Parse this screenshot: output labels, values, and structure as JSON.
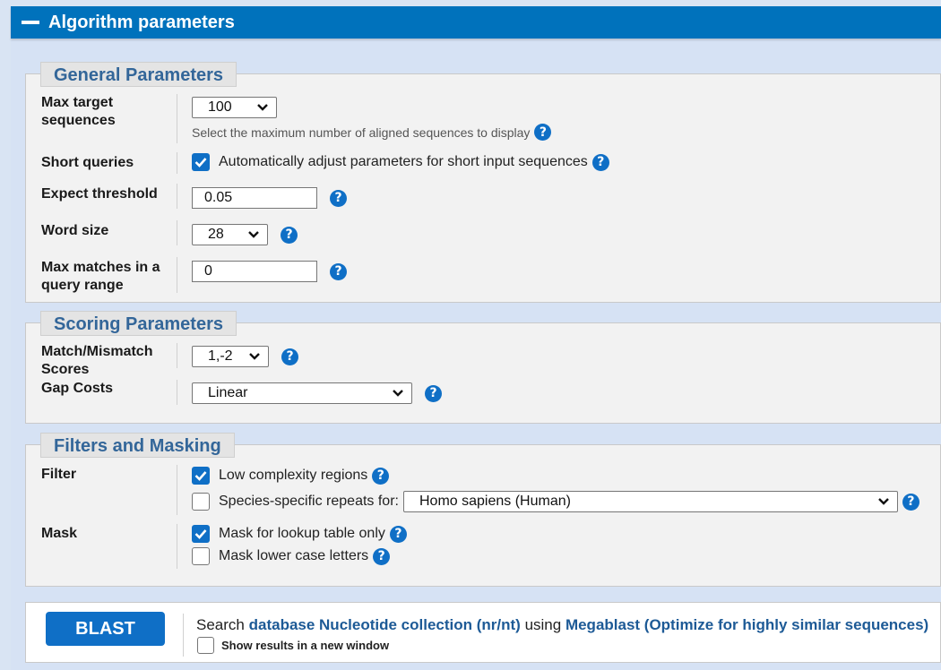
{
  "header": {
    "title": "Algorithm parameters"
  },
  "general": {
    "legend": "General Parameters",
    "max_target": {
      "label": "Max target sequences",
      "label_line1": "Max target",
      "label_line2": "sequences",
      "value": "100",
      "hint": "Select the maximum number of aligned sequences to display"
    },
    "short_queries": {
      "label": "Short queries",
      "checkbox_label": "Automatically adjust parameters for short input sequences",
      "checked": true
    },
    "expect": {
      "label": "Expect threshold",
      "value": "0.05"
    },
    "word_size": {
      "label": "Word size",
      "value": "28"
    },
    "max_matches": {
      "label_line1": "Max matches in a",
      "label_line2": "query range",
      "value": "0"
    }
  },
  "scoring": {
    "legend": "Scoring Parameters",
    "match_mismatch": {
      "label_line1": "Match/Mismatch",
      "label_line2": "Scores",
      "value": "1,-2"
    },
    "gap_costs": {
      "label": "Gap Costs",
      "value": "Linear"
    }
  },
  "filters": {
    "legend": "Filters and Masking",
    "filter": {
      "label": "Filter",
      "low_complexity": {
        "label": "Low complexity regions",
        "checked": true
      },
      "species_repeats": {
        "label": "Species-specific repeats for:",
        "checked": false,
        "value": "Homo sapiens (Human)"
      }
    },
    "mask": {
      "label": "Mask",
      "lookup": {
        "label": "Mask for lookup table only",
        "checked": true
      },
      "lower_case": {
        "label": "Mask lower case letters",
        "checked": false
      }
    }
  },
  "submit": {
    "button": "BLAST",
    "search_prefix": "Search",
    "database_link": "database Nucleotide collection (nr/nt)",
    "using_word": "using",
    "program_link": "Megablast (Optimize for highly similar sequences)",
    "new_window": {
      "label": "Show results in a new window",
      "checked": false
    }
  },
  "help_glyph": "?",
  "colors": {
    "header_bg": "#0072bc",
    "accent": "#0f6fc6",
    "legend_text": "#336699",
    "link": "#1d5a96"
  }
}
